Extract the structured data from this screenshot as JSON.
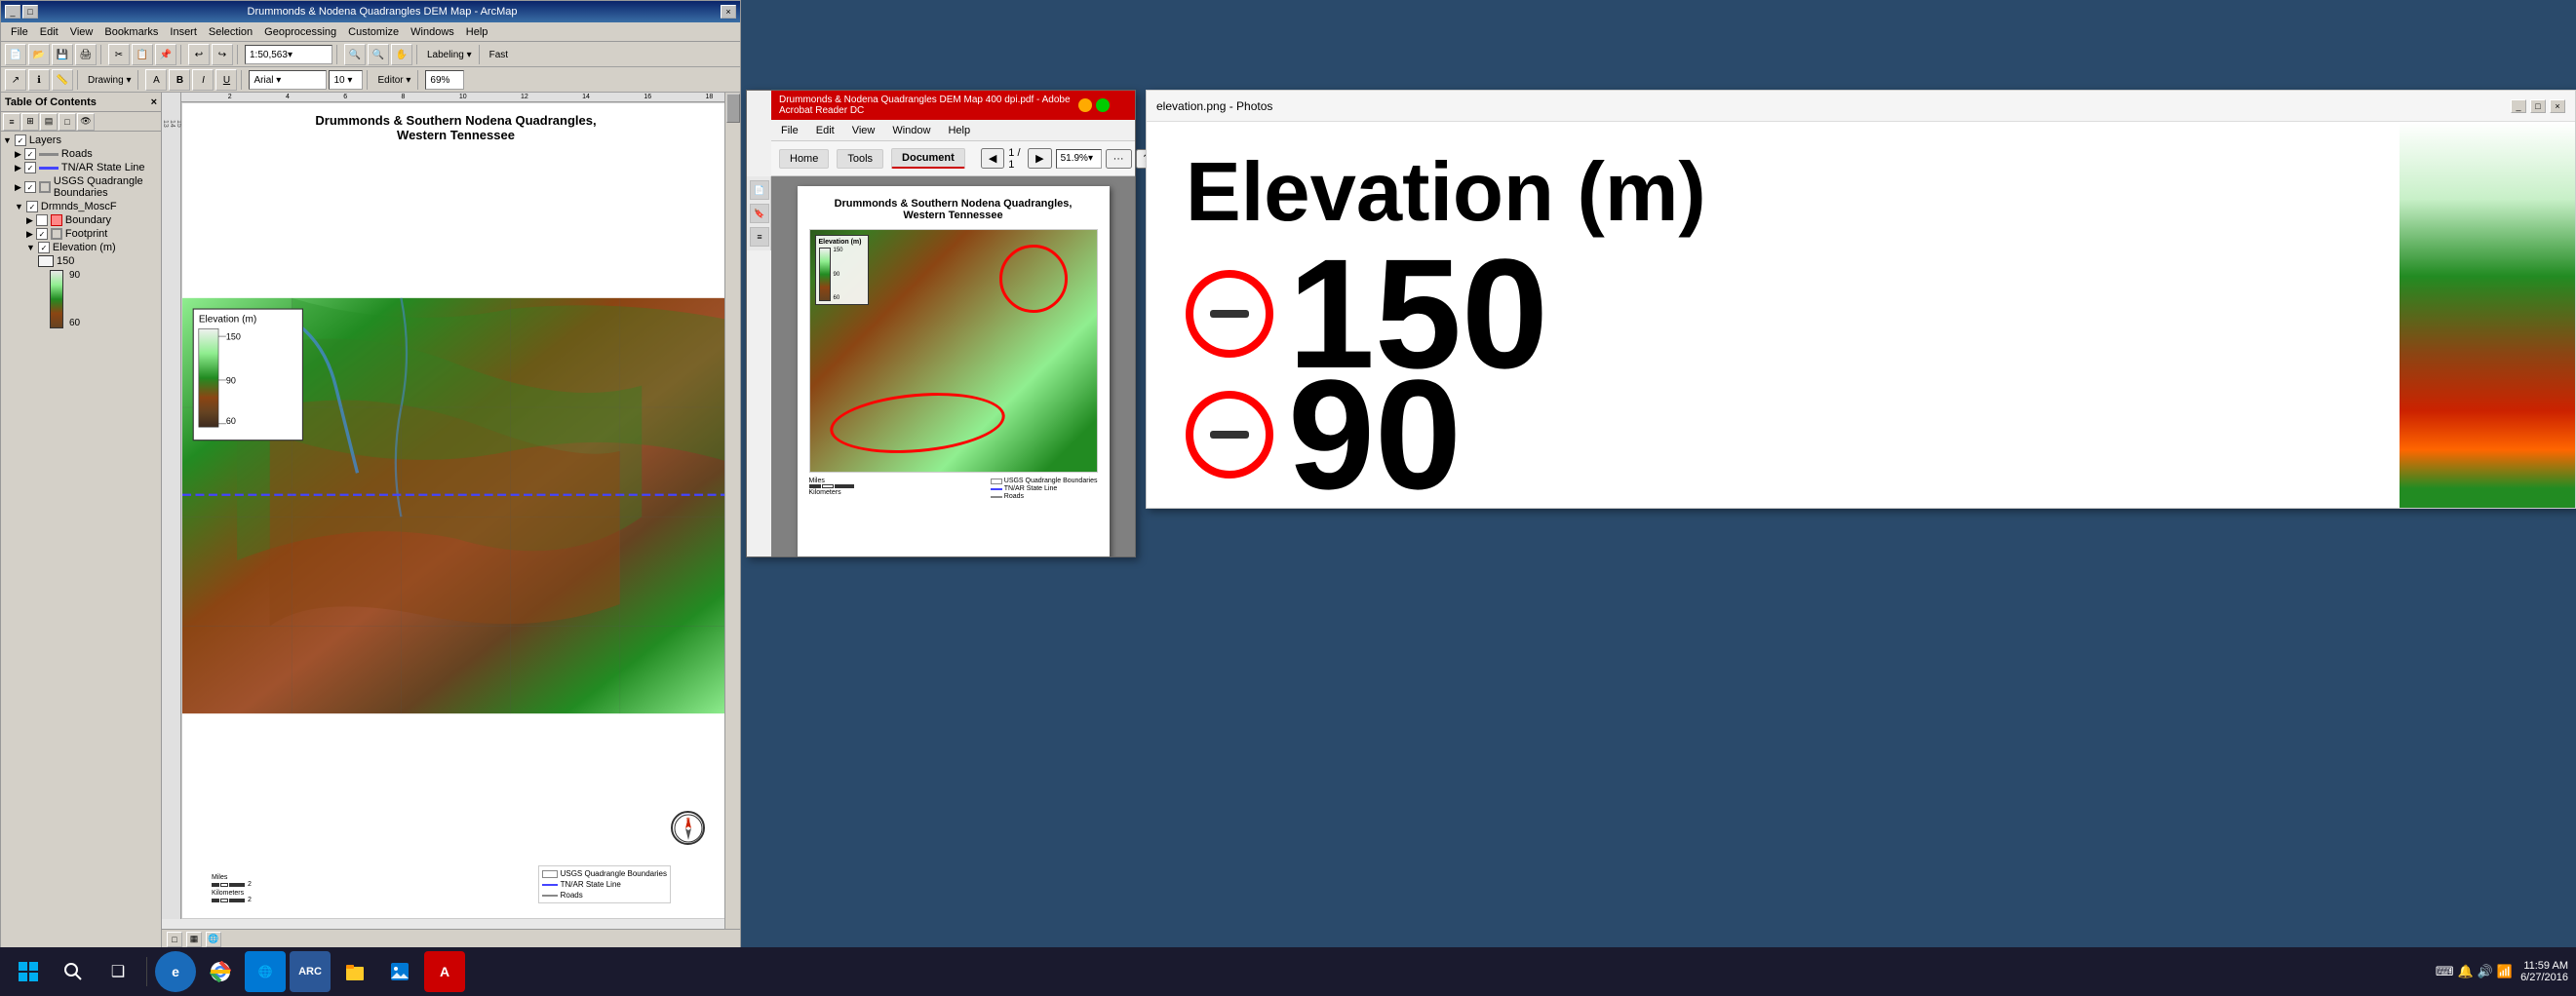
{
  "arcgis": {
    "title": "Drummonds & Nodena Quadrangles DEM Map - ArcMap",
    "titlebar_controls": [
      "-",
      "□",
      "×"
    ],
    "menu_items": [
      "File",
      "Edit",
      "View",
      "Bookmarks",
      "Insert",
      "Selection",
      "Geoprocessing",
      "Customize",
      "Windows",
      "Help"
    ],
    "toolbar1": {
      "scale": "1:50,563",
      "buttons": [
        "new",
        "open",
        "save",
        "print",
        "cut",
        "copy",
        "paste",
        "undo",
        "redo",
        "add_data",
        "editor"
      ]
    },
    "toolbar2": {
      "drawing": "Drawing ▾",
      "font": "Arial",
      "size": "10",
      "editor": "Editor ▾"
    },
    "toc": {
      "title": "Table Of Contents",
      "layers_label": "Layers",
      "items": [
        {
          "name": "Roads",
          "indent": 1,
          "checked": true
        },
        {
          "name": "TN/AR State Line",
          "indent": 1,
          "checked": true
        },
        {
          "name": "USGS Quadrangle Boundaries",
          "indent": 1,
          "checked": true
        },
        {
          "name": "Drmnds_MoscF",
          "indent": 1,
          "checked": true
        },
        {
          "name": "Boundary",
          "indent": 2,
          "checked": false
        },
        {
          "name": "Footprint",
          "indent": 2,
          "checked": true
        },
        {
          "name": "Elevation (m)",
          "indent": 2,
          "checked": true
        },
        {
          "name": "150",
          "indent": 4,
          "is_legend": true
        },
        {
          "name": "90",
          "indent": 4,
          "is_legend": true
        },
        {
          "name": "60",
          "indent": 4,
          "is_legend": true
        }
      ]
    },
    "map": {
      "title_line1": "Drummonds & Southern Nodena Quadrangles,",
      "title_line2": "Western Tennessee",
      "legend": {
        "title": "Elevation (m)",
        "values": [
          "150",
          "90",
          "60"
        ]
      }
    }
  },
  "acrobat": {
    "title": "Drummonds & Nodena Quadrangles DEM Map 400 dpi.pdf - Adobe Acrobat Reader DC",
    "menu_items": [
      "File",
      "Edit",
      "View",
      "Window",
      "Help"
    ],
    "nav_items": [
      "Home",
      "Tools",
      "Document"
    ],
    "page_info": "1 / 1",
    "zoom": "51.9%",
    "page_title_line1": "Drummonds & Southern Nodena Quadrangles,",
    "page_title_line2": "Western Tennessee",
    "legend": {
      "title": "Elevation (m)",
      "values": [
        "150",
        "90",
        "60"
      ]
    },
    "annotations": [
      "circle_top",
      "oval_bottom"
    ]
  },
  "photos": {
    "title": "elevation.png - Photos",
    "win_controls": [
      "-",
      "□",
      "×"
    ],
    "elevation_title": "Elevation (m)",
    "value_150": "150",
    "value_90": "90",
    "dash": "-"
  },
  "taskbar": {
    "icons": [
      {
        "name": "windows",
        "symbol": "⊞"
      },
      {
        "name": "cortana",
        "symbol": "◯"
      },
      {
        "name": "task-view",
        "symbol": "❑❑"
      },
      {
        "name": "edge",
        "symbol": "e"
      },
      {
        "name": "chrome",
        "symbol": "◉"
      },
      {
        "name": "network",
        "symbol": "🌐"
      },
      {
        "name": "arcgis",
        "symbol": "A"
      },
      {
        "name": "files",
        "symbol": "📁"
      },
      {
        "name": "photos",
        "symbol": "🖼"
      },
      {
        "name": "acrobat",
        "symbol": "A"
      }
    ],
    "time": "11:59 AM",
    "date": "6/27/2016",
    "sys_icons": [
      "🔔",
      "🔊",
      "📶",
      "⌨"
    ]
  }
}
